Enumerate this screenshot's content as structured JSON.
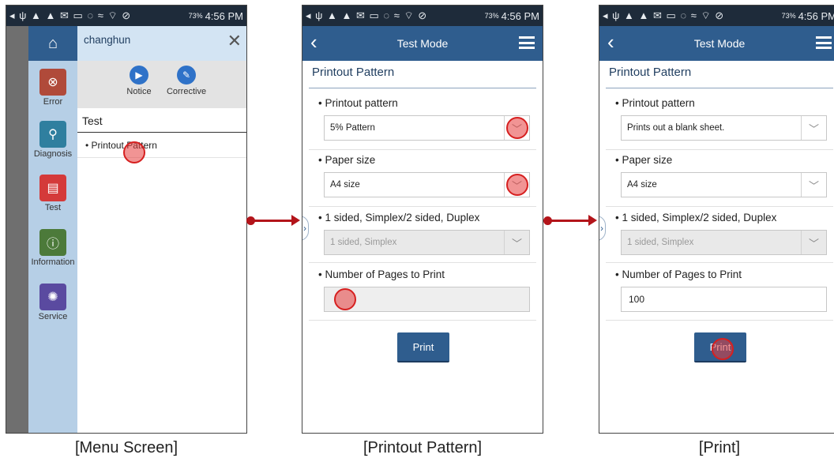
{
  "status_bar": {
    "icons": "◂ ψ ▲ ▲ ✉ ▭   ◌ ≈ ⌔ ⊘",
    "battery": "73%",
    "time": "4:56 PM"
  },
  "menu_screen": {
    "caption": "[Menu Screen]",
    "user": "changhun",
    "nav_items": [
      {
        "label": "Error",
        "icon": "error-icon",
        "color": "#b04a3a"
      },
      {
        "label": "Diagnosis",
        "icon": "search-icon",
        "color": "#2f7f9f"
      },
      {
        "label": "Test",
        "icon": "printer-icon",
        "color": "#d43a3a"
      },
      {
        "label": "Information",
        "icon": "info-icon",
        "color": "#4c7a3a"
      },
      {
        "label": "Service",
        "icon": "gear-icon",
        "color": "#5a4aa0"
      }
    ],
    "quick_actions": [
      {
        "label": "Notice",
        "icon": "notice-icon"
      },
      {
        "label": "Corrective",
        "icon": "edit-icon"
      }
    ],
    "section": "Test",
    "sub_item": "• Printout Pattern"
  },
  "printout_screen": {
    "caption": "[Printout Pattern]",
    "nav_title": "Test Mode",
    "section_title": "Printout Pattern",
    "fields": {
      "pattern_label": "• Printout pattern",
      "pattern_value": "5% Pattern",
      "paper_label": "• Paper size",
      "paper_value": "A4 size",
      "sided_label": "• 1 sided, Simplex/2 sided, Duplex",
      "sided_value": "1 sided, Simplex",
      "pages_label": "• Number of Pages to Print",
      "pages_value": ""
    },
    "print_button": "Print"
  },
  "print_screen": {
    "caption": "[Print]",
    "nav_title": "Test Mode",
    "section_title": "Printout Pattern",
    "fields": {
      "pattern_label": "• Printout pattern",
      "pattern_value": "Prints out a blank sheet.",
      "paper_label": "• Paper size",
      "paper_value": "A4 size",
      "sided_label": "• 1 sided, Simplex/2 sided, Duplex",
      "sided_value": "1 sided, Simplex",
      "pages_label": "• Number of Pages to Print",
      "pages_value": "100"
    },
    "print_button": "Print"
  },
  "colors": {
    "nav_blue": "#2f5d8e",
    "marker_red": "#d62020",
    "arrow_red": "#b3141a"
  }
}
